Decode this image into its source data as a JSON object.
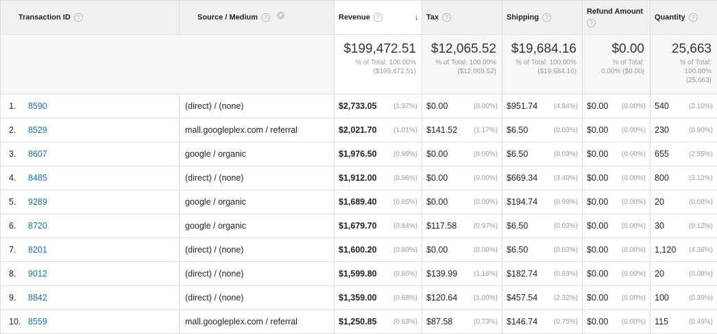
{
  "headers": {
    "transaction_id": "Transaction ID",
    "source_medium": "Source / Medium",
    "revenue": "Revenue",
    "tax": "Tax",
    "shipping": "Shipping",
    "refund_amount": "Refund Amount",
    "quantity": "Quantity",
    "help_glyph": "?",
    "remove_glyph": "×",
    "sort_glyph": "↓"
  },
  "totals": {
    "revenue": {
      "value": "$199,472.51",
      "sub1": "% of Total: 100.00%",
      "sub2": "($199,472.51)"
    },
    "tax": {
      "value": "$12,065.52",
      "sub1": "% of Total: 100.00%",
      "sub2": "($12,065.52)"
    },
    "shipping": {
      "value": "$19,684.16",
      "sub1": "% of Total: 100.00%",
      "sub2": "($19,684.16)"
    },
    "refund": {
      "value": "$0.00",
      "sub1": "% of Total:",
      "sub2": "0.00% ($0.00)"
    },
    "quantity": {
      "value": "25,663",
      "sub1": "% of Total:",
      "sub2": "100.00%",
      "sub3": "(25,663)"
    }
  },
  "rows": [
    {
      "index": "1.",
      "id": "8590",
      "source": "(direct) / (none)",
      "revenue": "$2,733.05",
      "revenue_pct": "(1.37%)",
      "tax": "$0.00",
      "tax_pct": "(0.00%)",
      "shipping": "$951.74",
      "shipping_pct": "(4.84%)",
      "refund": "$0.00",
      "refund_pct": "(0.00%)",
      "quantity": "540",
      "quantity_pct": "(2.10%)"
    },
    {
      "index": "2.",
      "id": "8529",
      "source": "mall.googleplex.com / referral",
      "revenue": "$2,021.70",
      "revenue_pct": "(1.01%)",
      "tax": "$141.52",
      "tax_pct": "(1.17%)",
      "shipping": "$6.50",
      "shipping_pct": "(0.03%)",
      "refund": "$0.00",
      "refund_pct": "(0.00%)",
      "quantity": "230",
      "quantity_pct": "(0.90%)"
    },
    {
      "index": "3.",
      "id": "8607",
      "source": "google / organic",
      "revenue": "$1,976.50",
      "revenue_pct": "(0.99%)",
      "tax": "$0.00",
      "tax_pct": "(0.00%)",
      "shipping": "$6.50",
      "shipping_pct": "(0.03%)",
      "refund": "$0.00",
      "refund_pct": "(0.00%)",
      "quantity": "655",
      "quantity_pct": "(2.55%)"
    },
    {
      "index": "4.",
      "id": "8485",
      "source": "(direct) / (none)",
      "revenue": "$1,912.00",
      "revenue_pct": "(0.96%)",
      "tax": "$0.00",
      "tax_pct": "(0.00%)",
      "shipping": "$669.34",
      "shipping_pct": "(3.40%)",
      "refund": "$0.00",
      "refund_pct": "(0.00%)",
      "quantity": "800",
      "quantity_pct": "(3.12%)"
    },
    {
      "index": "5.",
      "id": "9289",
      "source": "google / organic",
      "revenue": "$1,689.40",
      "revenue_pct": "(0.85%)",
      "tax": "$0.00",
      "tax_pct": "(0.00%)",
      "shipping": "$194.74",
      "shipping_pct": "(0.99%)",
      "refund": "$0.00",
      "refund_pct": "(0.00%)",
      "quantity": "20",
      "quantity_pct": "(0.08%)"
    },
    {
      "index": "6.",
      "id": "8720",
      "source": "google / organic",
      "revenue": "$1,679.70",
      "revenue_pct": "(0.84%)",
      "tax": "$117.58",
      "tax_pct": "(0.97%)",
      "shipping": "$6.50",
      "shipping_pct": "(0.03%)",
      "refund": "$0.00",
      "refund_pct": "(0.00%)",
      "quantity": "30",
      "quantity_pct": "(0.12%)"
    },
    {
      "index": "7.",
      "id": "8201",
      "source": "(direct) / (none)",
      "revenue": "$1,600.20",
      "revenue_pct": "(0.80%)",
      "tax": "$0.00",
      "tax_pct": "(0.00%)",
      "shipping": "$6.50",
      "shipping_pct": "(0.03%)",
      "refund": "$0.00",
      "refund_pct": "(0.00%)",
      "quantity": "1,120",
      "quantity_pct": "(4.36%)"
    },
    {
      "index": "8.",
      "id": "9012",
      "source": "(direct) / (none)",
      "revenue": "$1,599.80",
      "revenue_pct": "(0.80%)",
      "tax": "$139.99",
      "tax_pct": "(1.16%)",
      "shipping": "$182.74",
      "shipping_pct": "(0.93%)",
      "refund": "$0.00",
      "refund_pct": "(0.00%)",
      "quantity": "20",
      "quantity_pct": "(0.08%)"
    },
    {
      "index": "9.",
      "id": "8842",
      "source": "(direct) / (none)",
      "revenue": "$1,359.00",
      "revenue_pct": "(0.68%)",
      "tax": "$120.64",
      "tax_pct": "(1.00%)",
      "shipping": "$457.54",
      "shipping_pct": "(2.32%)",
      "refund": "$0.00",
      "refund_pct": "(0.00%)",
      "quantity": "100",
      "quantity_pct": "(0.39%)"
    },
    {
      "index": "10.",
      "id": "8559",
      "source": "mall.googleplex.com / referral",
      "revenue": "$1,250.85",
      "revenue_pct": "(0.63%)",
      "tax": "$87.58",
      "tax_pct": "(0.73%)",
      "shipping": "$146.74",
      "shipping_pct": "(0.75%)",
      "refund": "$0.00",
      "refund_pct": "(0.00%)",
      "quantity": "115",
      "quantity_pct": "(0.45%)"
    }
  ],
  "colors": {
    "link": "#1a6fb5",
    "header_bg": "#f1f1f1",
    "border": "#dddddd"
  },
  "sort": {
    "column": "revenue",
    "direction": "descending"
  }
}
